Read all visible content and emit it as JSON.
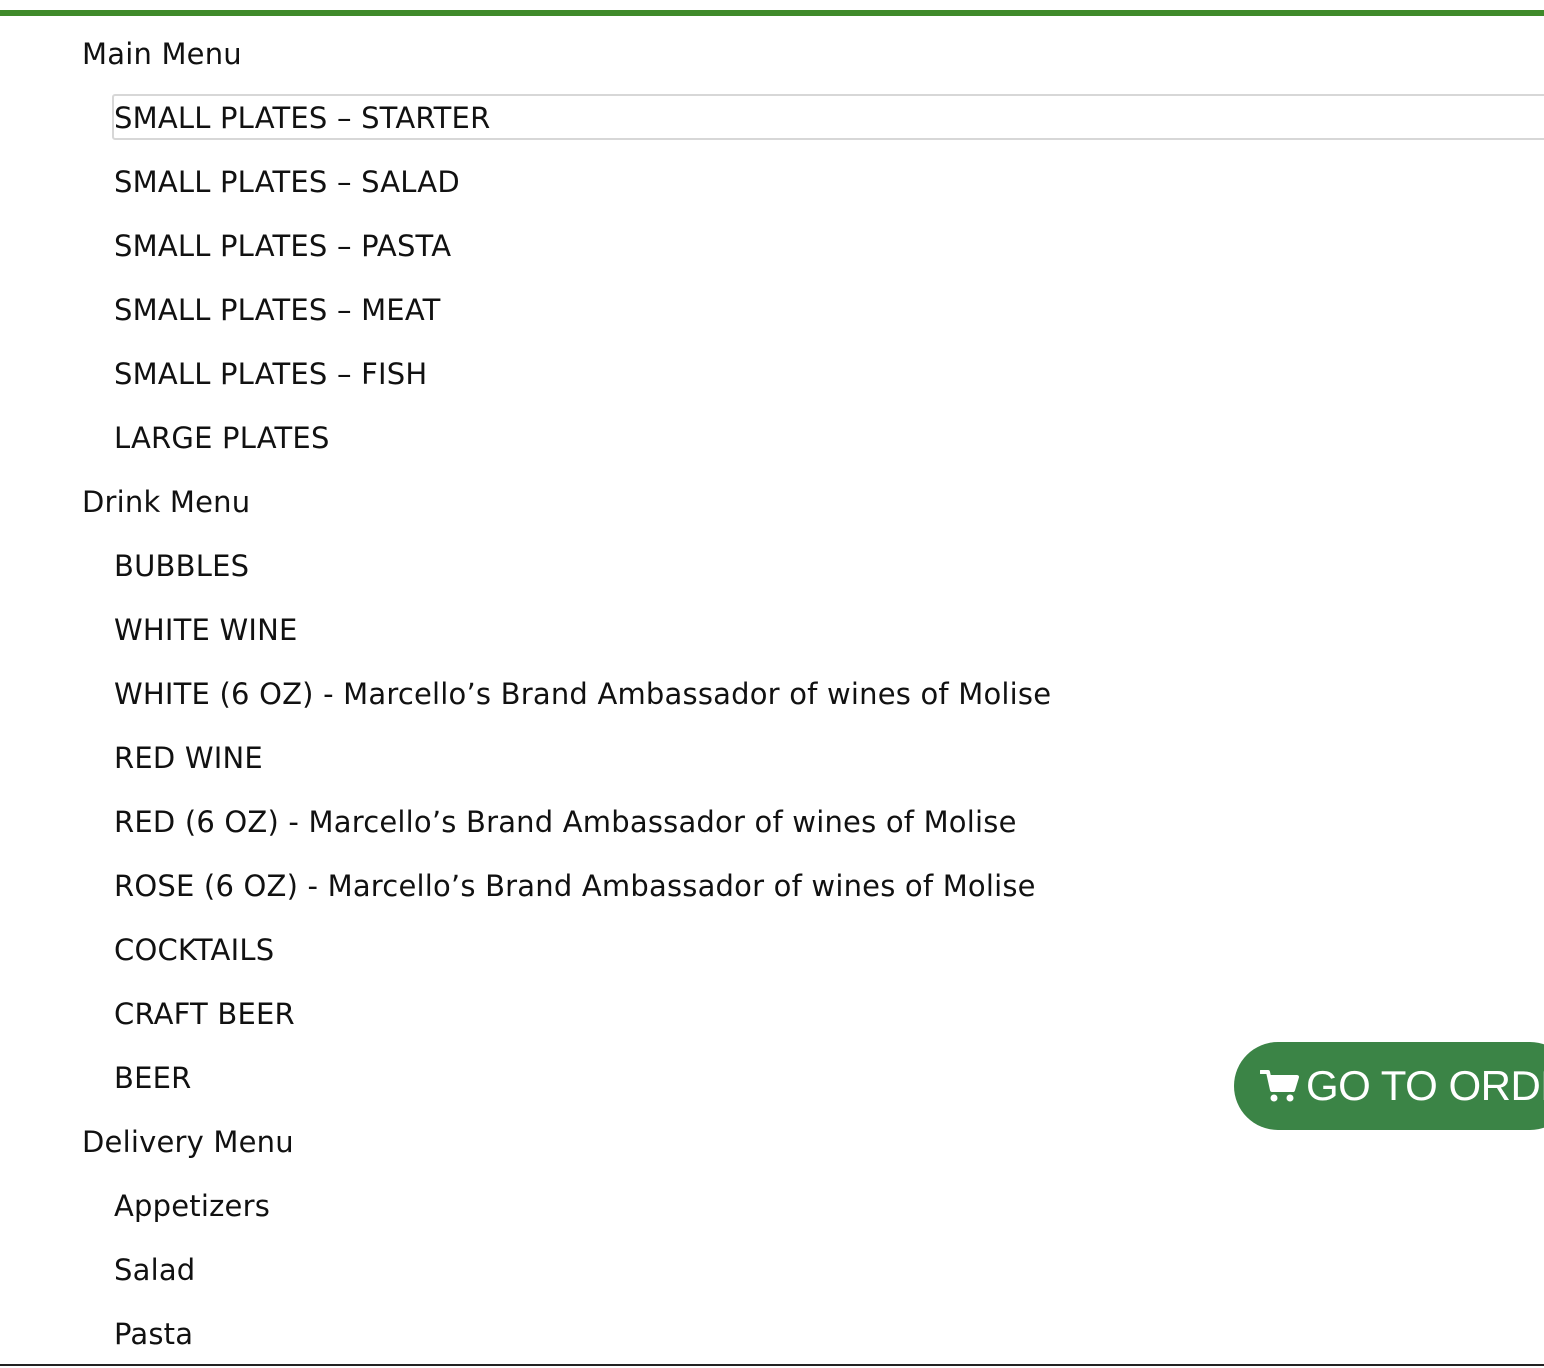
{
  "menu": {
    "groups": [
      {
        "label": "Main Menu",
        "items": [
          "SMALL PLATES – STARTER",
          "SMALL PLATES – SALAD",
          "SMALL PLATES – PASTA",
          "SMALL PLATES – MEAT",
          "SMALL PLATES – FISH",
          "LARGE PLATES"
        ]
      },
      {
        "label": "Drink Menu",
        "items": [
          "BUBBLES",
          "WHITE WINE",
          "WHITE (6 OZ) - Marcello’s Brand Ambassador of wines of Molise",
          "RED WINE",
          "RED (6 OZ) - Marcello’s Brand Ambassador of wines of Molise",
          "ROSE (6 OZ) - Marcello’s Brand Ambassador of wines of Molise",
          "COCKTAILS",
          "CRAFT BEER",
          "BEER"
        ]
      },
      {
        "label": "Delivery Menu",
        "items": [
          "Appetizers",
          "Salad",
          "Pasta"
        ]
      }
    ],
    "selected_item": "SMALL PLATES – STARTER"
  },
  "order_button": {
    "label": "GO TO ORDE",
    "icon": "cart-icon"
  },
  "colors": {
    "accent": "#3f8a2a",
    "button": "#3b8446"
  }
}
